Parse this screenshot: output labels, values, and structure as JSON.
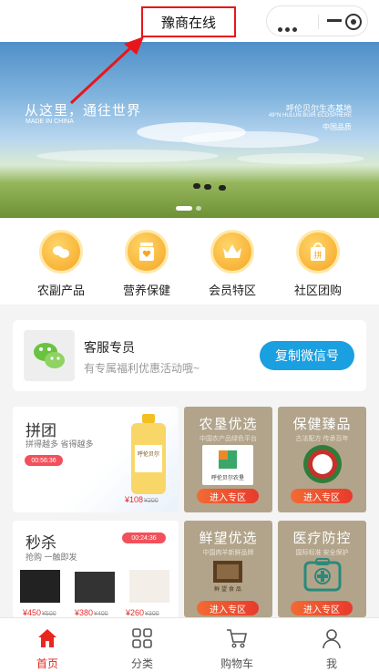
{
  "header": {
    "title": "豫商在线"
  },
  "banner": {
    "slogan": "从这里，通往世界",
    "made": "MADE IN CHINA",
    "right_title": "呼伦贝尔生态基地",
    "right_en": "49°N HULUN BUIR ECOSPHERE",
    "right_sub": "中国品质"
  },
  "categories": [
    {
      "label": "农副产品",
      "icon": "peanut-icon"
    },
    {
      "label": "营养保健",
      "icon": "health-jar-icon"
    },
    {
      "label": "会员特区",
      "icon": "crown-icon"
    },
    {
      "label": "社区团购",
      "icon": "group-buy-bag-icon"
    }
  ],
  "service": {
    "title": "客服专员",
    "subtitle": "有专属福利优惠活动哦~",
    "button": "复制微信号"
  },
  "group_buy": {
    "title": "拼团",
    "subtitle": "拼得越多 省得越多",
    "timer": "00:56:36",
    "price": "¥108",
    "old_price": "¥200",
    "product_brand": "呼伦贝尔"
  },
  "flash_sale": {
    "title": "秒杀",
    "subtitle": "抢购 一触即发",
    "timer": "00:24:36",
    "items": [
      {
        "price": "¥450",
        "old": "¥500"
      },
      {
        "price": "¥380",
        "old": "¥400"
      },
      {
        "price": "¥260",
        "old": "¥300"
      }
    ]
  },
  "tiles": [
    {
      "title": "农垦优选",
      "sub": "中国农产品绿色平台",
      "brand": "呼伦贝尔农垦",
      "button": "进入专区"
    },
    {
      "title": "保健臻品",
      "sub": "古法配方 传承百年",
      "button": "进入专区"
    },
    {
      "title": "鲜望优选",
      "sub": "中国肉羊新鲜品牌",
      "brand": "鲜  望  食  品",
      "button": "进入专区"
    },
    {
      "title": "医疗防控",
      "sub": "国际标准 安全保护",
      "button": "进入专区"
    }
  ],
  "tabbar": [
    {
      "label": "首页",
      "active": true
    },
    {
      "label": "分类",
      "active": false
    },
    {
      "label": "购物车",
      "active": false
    },
    {
      "label": "我",
      "active": false
    }
  ],
  "colors": {
    "accent_red": "#e8271f",
    "gold": "#f5a623",
    "wechat_blue": "#1a9fe0",
    "tile_brown": "#b2a48b"
  }
}
